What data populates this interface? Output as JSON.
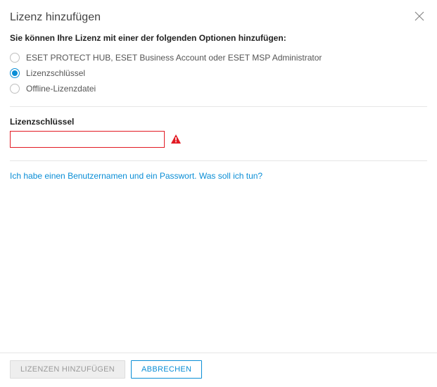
{
  "header": {
    "title": "Lizenz hinzufügen"
  },
  "instruction": "Sie können Ihre Lizenz mit einer der folgenden Optionen hinzufügen:",
  "options": [
    {
      "label": "ESET PROTECT HUB, ESET Business Account oder ESET MSP Administrator",
      "selected": false
    },
    {
      "label": "Lizenzschlüssel",
      "selected": true
    },
    {
      "label": "Offline-Lizenzdatei",
      "selected": false
    }
  ],
  "field": {
    "label": "Lizenzschlüssel",
    "value": "",
    "error": true
  },
  "helpLink": "Ich habe einen Benutzernamen und ein Passwort. Was soll ich tun?",
  "footer": {
    "primary": "LIZENZEN HINZUFÜGEN",
    "secondary": "ABBRECHEN"
  }
}
